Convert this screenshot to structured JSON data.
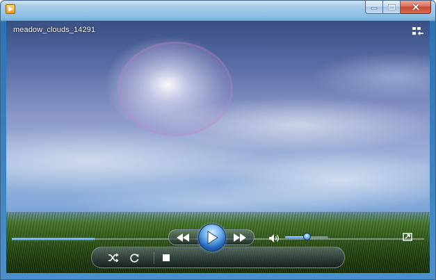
{
  "window": {
    "app_icon": "media-player-app-icon",
    "caption_buttons": [
      "minimize-icon",
      "maximize-icon",
      "close-icon"
    ]
  },
  "video": {
    "title": "meadow_clouds_14291",
    "scene": "sky-clouds-over-grass"
  },
  "seek": {
    "progress": 0.2
  },
  "controls": {
    "shuffle_icon": "shuffle-icon",
    "repeat_icon": "repeat-icon",
    "stop_icon": "stop-icon",
    "previous_icon": "previous-icon",
    "play_icon": "play-icon",
    "next_icon": "next-icon",
    "mute_icon": "speaker-icon",
    "volume_level": 0.5,
    "switch_library_icon": "switch-to-library-icon",
    "fullscreen_icon": "fullscreen-icon"
  },
  "colors": {
    "accent": "#3c8fdc",
    "window_frame": "#4a90cc",
    "close_button": "#c84a32"
  }
}
